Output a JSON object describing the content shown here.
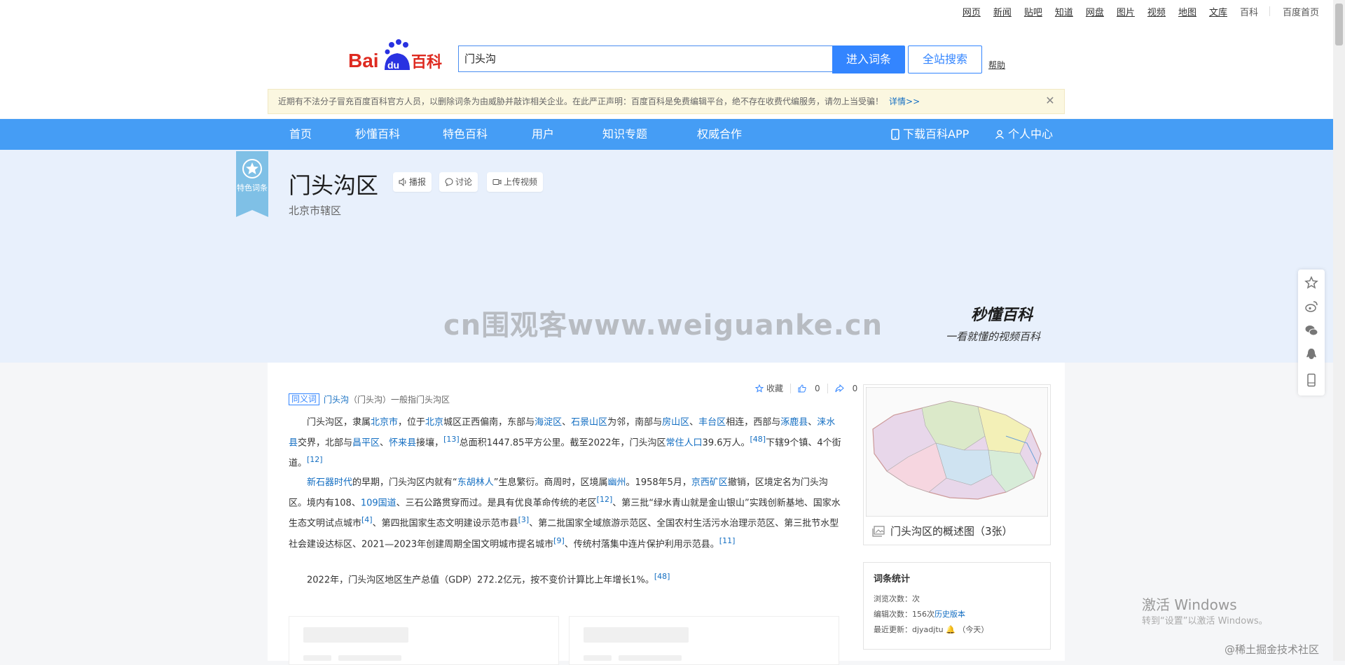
{
  "topnav": {
    "items": [
      "网页",
      "新闻",
      "贴吧",
      "知道",
      "网盘",
      "图片",
      "视频",
      "地图",
      "文库",
      "百科"
    ],
    "home": "百度首页"
  },
  "search": {
    "value": "门头沟",
    "enter_label": "进入词条",
    "site_search_label": "全站搜索",
    "help_label": "帮助"
  },
  "notice": {
    "text": "近期有不法分子冒充百度百科官方人员，以删除词条为由威胁并敲诈相关企业。在此严正声明：百度百科是免费编辑平台，绝不存在收费代编服务，请勿上当受骗！",
    "more": "详情>>"
  },
  "mainnav": {
    "items": [
      "首页",
      "秒懂百科",
      "特色百科",
      "用户",
      "知识专题",
      "权威合作"
    ],
    "download": "下载百科APP",
    "personal": "个人中心"
  },
  "entry": {
    "feature_tag": "特色词条",
    "title": "门头沟区",
    "subtitle": "北京市辖区",
    "broadcast": "播报",
    "discuss": "讨论",
    "upload_video": "上传视频"
  },
  "banner": {
    "watermark": "cn围观客www.weiguanke.cn",
    "miaodong_logo": "秒懂百科",
    "slogan": "一看就懂的视频百科"
  },
  "actions": {
    "collect": "收藏",
    "like_count": "0",
    "share_count": "0"
  },
  "synonym": {
    "tag": "同义词",
    "link": "门头沟",
    "text": "（门头沟）一般指门头沟区"
  },
  "paragraphs": {
    "p1": {
      "a": "门头沟区，隶属",
      "b": "北京市",
      "c": "，位于",
      "d": "北京",
      "e": "城区正西偏南，东部与",
      "f": "海淀区",
      "g": "、",
      "h": "石景山区",
      "i": "为邻，南部与",
      "j": "房山区",
      "k": "、",
      "l": "丰台区",
      "m": "相连，西部与",
      "n": "涿鹿县",
      "o": "、",
      "p": "涞水县",
      "q": "交界，北部与",
      "r": "昌平区",
      "s": "、",
      "t": "怀来县",
      "u": "接壤，",
      "ref1": "[13]",
      "v": "总面积1447.85平方公里。截至2022年，门头沟区",
      "w": "常住人口",
      "x": "39.6万人。",
      "ref2": "[48]",
      "y": "下辖9个镇、4个街道。",
      "ref3": "[12]"
    },
    "p2": {
      "a": "新石器时代",
      "b": "的早期，门头沟区内就有“",
      "c": "东胡林人",
      "d": "”生息繁衍。商周时，区境属",
      "e": "幽州",
      "f": "。1958年5月，",
      "g": "京西矿区",
      "h": "撤销，区境定名为门头沟区。境内有108、",
      "i": "109国道",
      "j": "、三石公路贯穿而过。是具有优良革命传统的老区",
      "ref1": "[12]",
      "k": "、第三批“绿水青山就是金山银山”实践创新基地、国家水生态文明试点城市",
      "ref2": "[4]",
      "l": "、第四批国家生态文明建设示范市县",
      "ref3": "[3]",
      "m": "、第二批国家全域旅游示范区、全国农村生活污水治理示范区、第三批节水型社会建设达标区、2021—2023年创建周期全国文明城市提名城市",
      "ref4": "[9]",
      "n": "、传统村落集中连片保护利用示范县。",
      "ref5": "[11]"
    },
    "p3": {
      "a": "2022年，门头沟区地区生产总值（GDP）272.2亿元，按不变价计算比上年增长1%。",
      "ref1": "[48]"
    }
  },
  "map_card": {
    "caption": "门头沟区的概述图（3张）"
  },
  "stats": {
    "title": "词条统计",
    "views_label": "浏览次数：次",
    "edits_label": "编辑次数：156次",
    "history_link": "历史版本",
    "updated_label": "最近更新：",
    "updated_user": "djyadjtu",
    "updated_time": "（今天）"
  },
  "overlay": {
    "activate_title": "激活 Windows",
    "activate_sub": "转到“设置”以激活 Windows。",
    "juejin": "@稀土掘金技术社区"
  },
  "colors": {
    "nav_blue": "#459df5",
    "link_blue": "#136ec2",
    "banner_bg": "#e8f0fc",
    "logo_red": "#de2a20",
    "logo_blue": "#2932e1"
  }
}
